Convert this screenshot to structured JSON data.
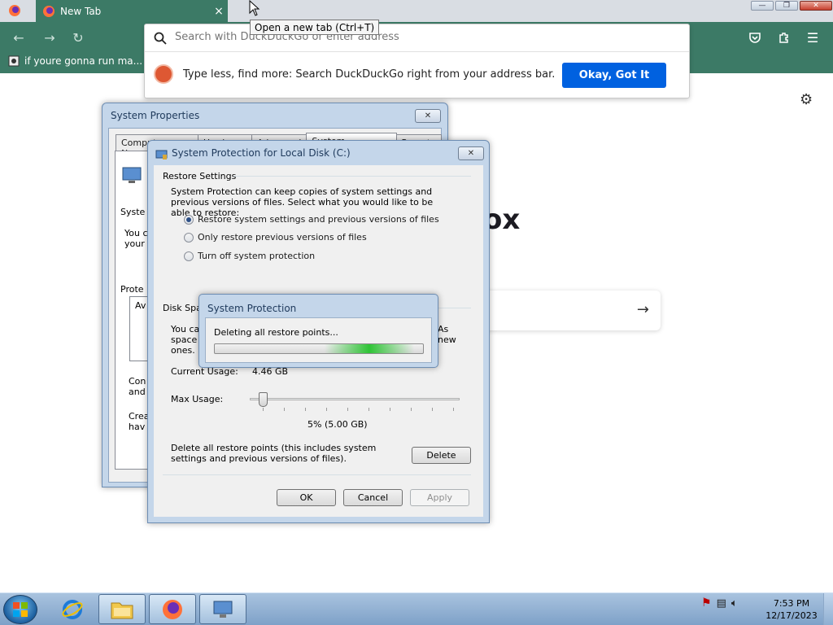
{
  "browser": {
    "tab_title": "New Tab",
    "tab_close": "×",
    "tooltip": "Open a new tab (Ctrl+T)",
    "url_placeholder": "Search with DuckDuckGo or enter address",
    "bookmark_label": "if youre gonna run ma...",
    "ddg_message": "Type less, find more: Search DuckDuckGo right from your address bar.",
    "ddg_button": "Okay, Got It",
    "logo_fragment": "ox",
    "accent": "#3c7a66",
    "button_color": "#0061e0"
  },
  "system_properties": {
    "title": "System Properties",
    "tabs": [
      "Computer Name",
      "Hardware",
      "Advanced",
      "System Protection",
      "Remote"
    ],
    "fragments": {
      "syst": "Syste",
      "you": "You c",
      "your": "your",
      "prote": "Prote",
      "av": "Av",
      "con": "Con",
      "and": "and",
      "crea": "Crea",
      "hav": "hav"
    }
  },
  "system_protection": {
    "title": "System Protection for Local Disk (C:)",
    "restore_heading": "Restore Settings",
    "restore_desc": "System Protection can keep copies of system settings and previous versions of files. Select what you would like to be able to restore:",
    "options": [
      "Restore system settings and previous versions of files",
      "Only restore previous versions of files",
      "Turn off system protection"
    ],
    "disk_heading": "Disk Spac",
    "disk_desc_start": "You ca",
    "disk_desc_line2": "space f",
    "disk_desc_line3": "ones.",
    "disk_as": "As",
    "disk_new": "new",
    "current_usage_label": "Current Usage:",
    "current_usage_value": "4.46 GB",
    "max_usage_label": "Max Usage:",
    "max_usage_value": "5% (5.00 GB)",
    "max_usage_percent": 5,
    "delete_desc": "Delete all restore points (this includes system settings and previous versions of files).",
    "delete_button": "Delete",
    "ok_button": "OK",
    "cancel_button": "Cancel",
    "apply_button": "Apply"
  },
  "progress_dialog": {
    "title": "System Protection",
    "message": "Deleting all restore points..."
  },
  "taskbar": {
    "clock_time": "7:53 PM",
    "clock_date": "12/17/2023"
  }
}
